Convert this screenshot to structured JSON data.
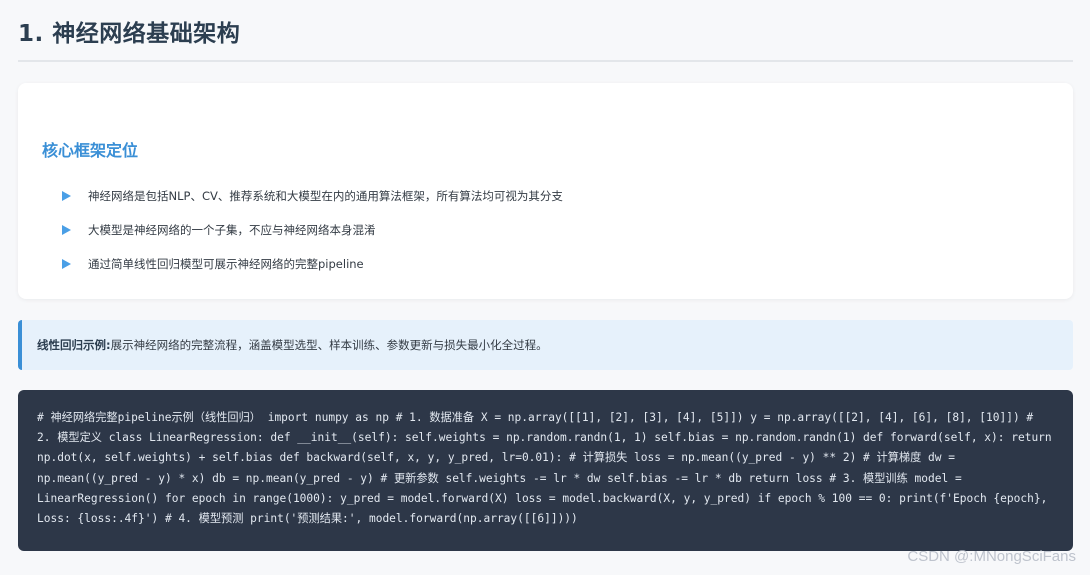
{
  "section": {
    "title": "1. 神经网络基础架构"
  },
  "card": {
    "heading": "核心框架定位",
    "bullets": [
      "神经网络是包括NLP、CV、推荐系统和大模型在内的通用算法框架，所有算法均可视为其分支",
      "大模型是神经网络的一个子集，不应与神经网络本身混淆",
      "通过简单线性回归模型可展示神经网络的完整pipeline"
    ]
  },
  "note": {
    "label": "线性回归示例:",
    "text": " 展示神经网络的完整流程，涵盖模型选型、样本训练、参数更新与损失最小化全过程。"
  },
  "code": {
    "text": "# 神经网络完整pipeline示例（线性回归） import numpy as np # 1. 数据准备 X = np.array([[1], [2], [3], [4], [5]]) y = np.array([[2], [4], [6], [8], [10]]) # 2. 模型定义 class LinearRegression: def __init__(self): self.weights = np.random.randn(1, 1) self.bias = np.random.randn(1) def forward(self, x): return np.dot(x, self.weights) + self.bias def backward(self, x, y, y_pred, lr=0.01): # 计算损失 loss = np.mean((y_pred - y) ** 2) # 计算梯度 dw = np.mean((y_pred - y) * x) db = np.mean(y_pred - y) # 更新参数 self.weights -= lr * dw self.bias -= lr * db return loss # 3. 模型训练 model = LinearRegression() for epoch in range(1000): y_pred = model.forward(X) loss = model.backward(X, y, y_pred) if epoch % 100 == 0: print(f'Epoch {epoch}, Loss: {loss:.4f}') # 4. 模型预测 print('预测结果:', model.forward(np.array([[6]])))"
  },
  "watermark": "CSDN @:MNongSciFans",
  "colors": {
    "accent": "#3a8fd6",
    "code_bg": "#2d3748",
    "note_bg": "#e6f1fb"
  }
}
